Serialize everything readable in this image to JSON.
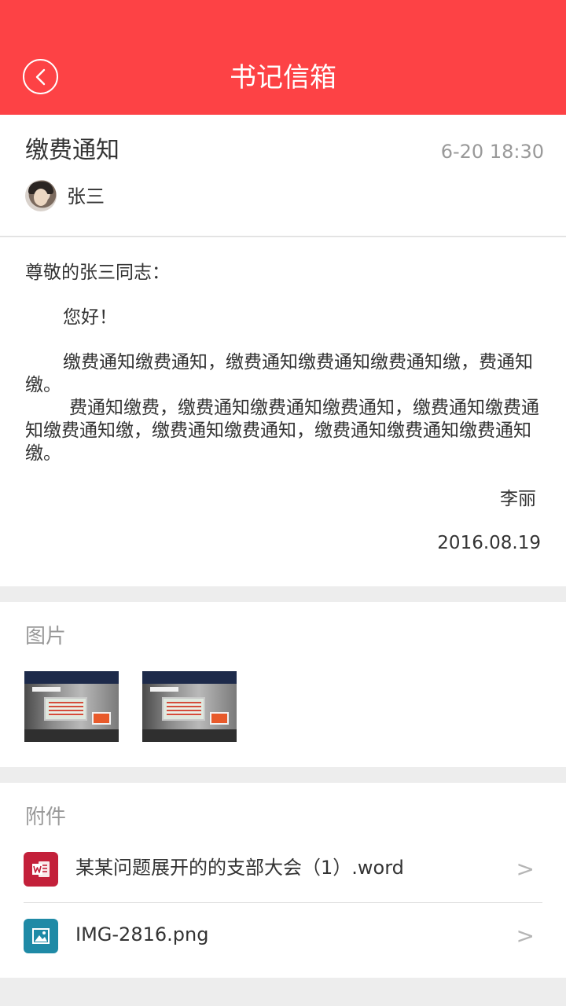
{
  "header": {
    "title": "书记信箱",
    "back_icon": "chevron-left-icon",
    "background_color": "#fd4245"
  },
  "message": {
    "subject": "缴费通知",
    "time": "6-20 18:30",
    "sender": "张三",
    "salutation": "尊敬的张三同志：",
    "greeting": "您好！",
    "paragraphs": [
      "缴费通知缴费通知，缴费通知缴费通知缴费通知缴，费通知缴。",
      "费通知缴费，缴费通知缴费通知缴费通知，缴费通知缴费通知缴费通知缴，缴费通知缴费通知，缴费通知缴费通知缴费通知缴。"
    ],
    "signature": "李丽",
    "sign_date": "2016.08.19"
  },
  "images": {
    "label": "图片",
    "items": [
      "photo-exhibition-hall",
      "photo-exhibition-hall"
    ]
  },
  "attachments": {
    "label": "附件",
    "items": [
      {
        "name": "某某问题展开的的支部大会（1）.word",
        "icon": "word-file-icon",
        "icon_color": "#c3203a",
        "arrow": ">"
      },
      {
        "name": "IMG-2816.png",
        "icon": "image-file-icon",
        "icon_color": "#1f8aa6",
        "arrow": ">"
      }
    ]
  }
}
